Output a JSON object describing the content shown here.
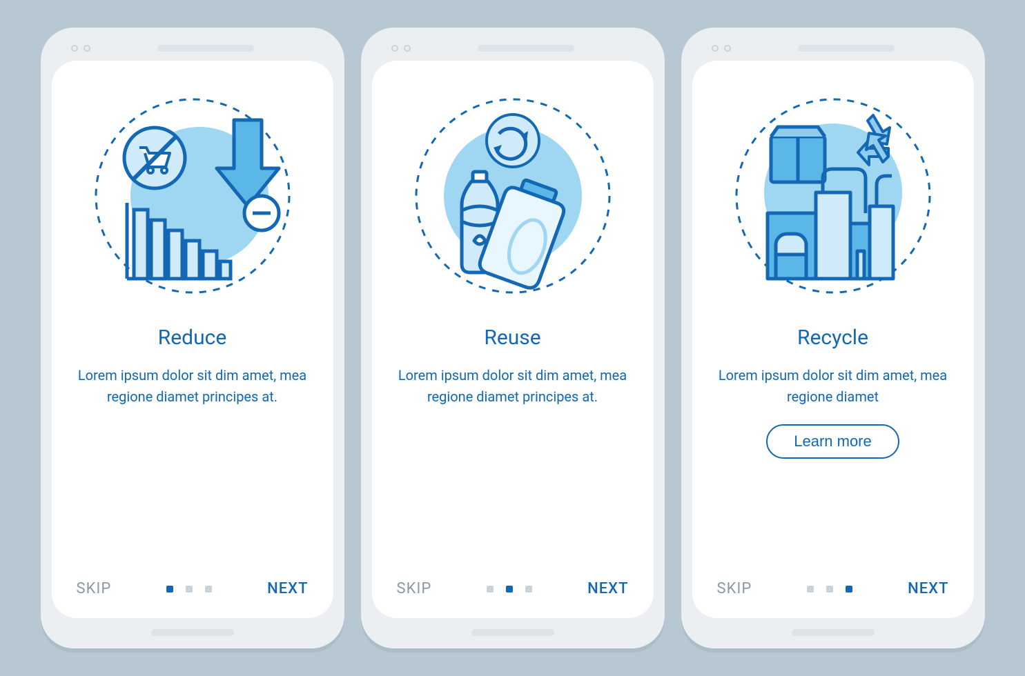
{
  "colors": {
    "primary": "#1367b3",
    "accent_light": "#9fd6f2",
    "accent_mid": "#5bb7e8",
    "muted": "#8a9aa6"
  },
  "screens": [
    {
      "title": "Reduce",
      "body": "Lorem ipsum dolor sit dim amet, mea regione diamet principes at.",
      "skip": "SKIP",
      "next": "NEXT",
      "active_dot": 0,
      "illustration": "reduce-illustration",
      "show_cta": false
    },
    {
      "title": "Reuse",
      "body": "Lorem ipsum dolor sit dim amet, mea regione diamet principes at.",
      "skip": "SKIP",
      "next": "NEXT",
      "active_dot": 1,
      "illustration": "reuse-illustration",
      "show_cta": false
    },
    {
      "title": "Recycle",
      "body": "Lorem ipsum dolor sit dim amet, mea regione diamet",
      "skip": "SKIP",
      "next": "NEXT",
      "active_dot": 2,
      "illustration": "recycle-illustration",
      "show_cta": true,
      "cta_label": "Learn more"
    }
  ],
  "pager_count": 3
}
